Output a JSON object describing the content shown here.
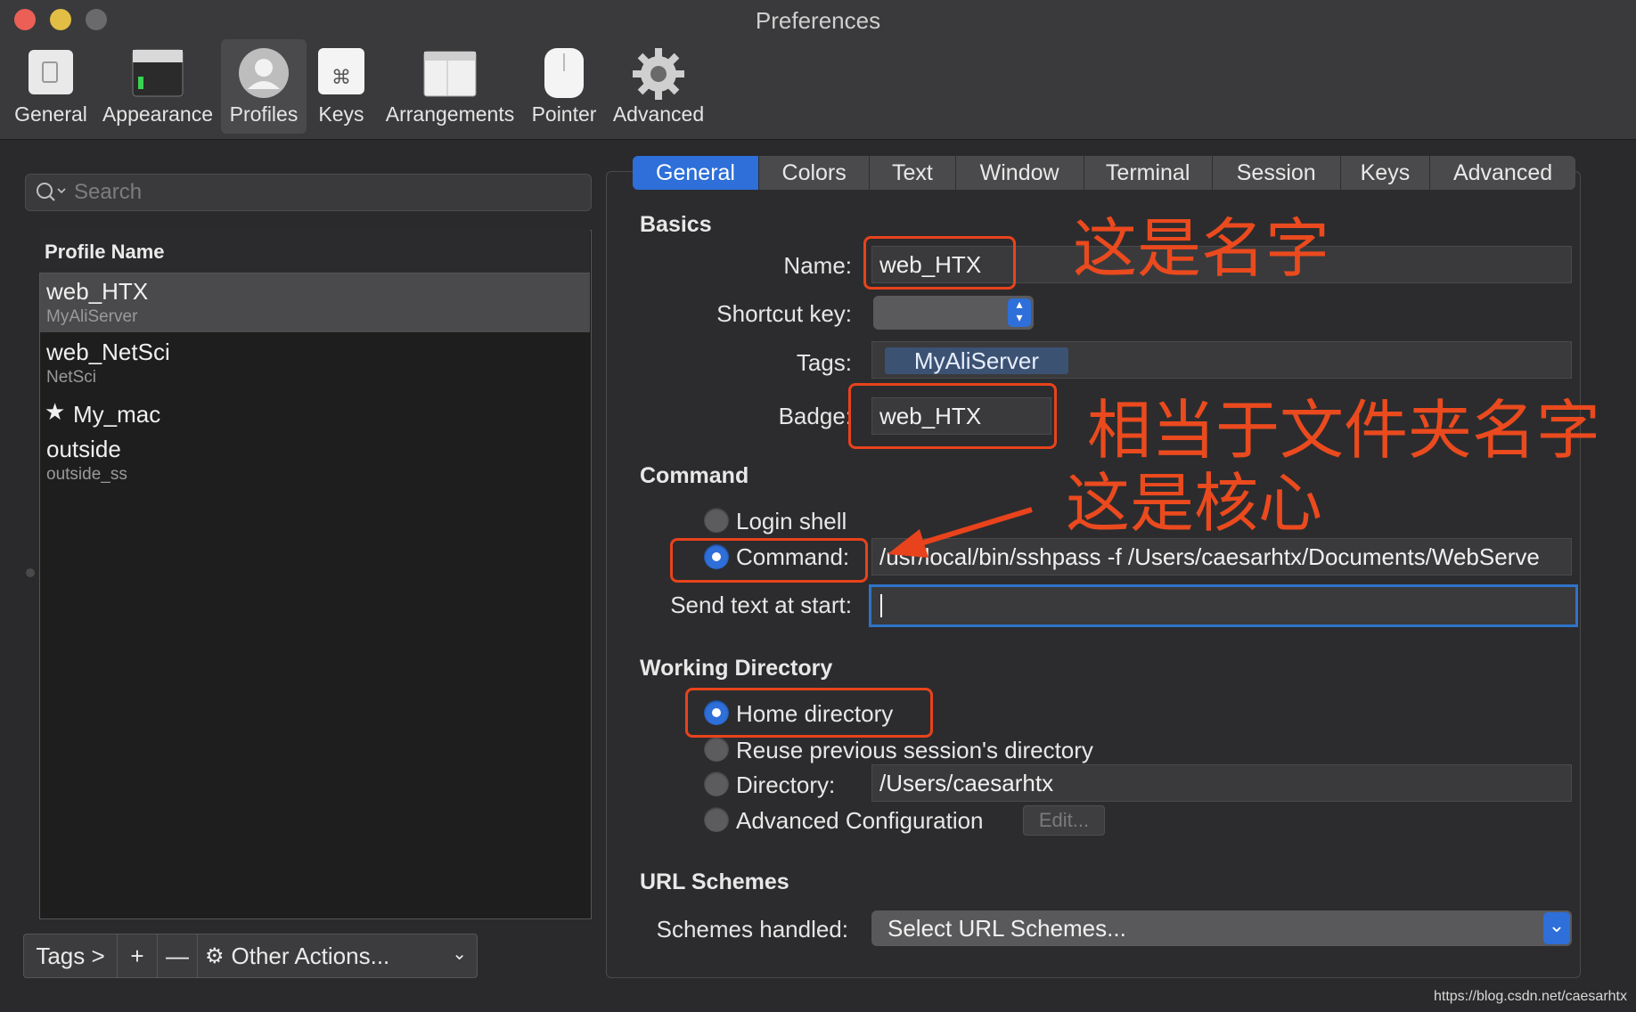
{
  "window": {
    "title": "Preferences"
  },
  "toolbar": {
    "items": [
      {
        "label": "General",
        "icon": "general-icon"
      },
      {
        "label": "Appearance",
        "icon": "appearance-icon"
      },
      {
        "label": "Profiles",
        "icon": "profiles-icon",
        "selected": true
      },
      {
        "label": "Keys",
        "icon": "keys-icon"
      },
      {
        "label": "Arrangements",
        "icon": "arrangements-icon"
      },
      {
        "label": "Pointer",
        "icon": "pointer-icon"
      },
      {
        "label": "Advanced",
        "icon": "gear-icon"
      }
    ]
  },
  "sidebar": {
    "search_placeholder": "Search",
    "column_header": "Profile Name",
    "profiles": [
      {
        "name": "web_HTX",
        "tag": "MyAliServer",
        "selected": true
      },
      {
        "name": "web_NetSci",
        "tag": "NetSci"
      },
      {
        "name": "My_mac",
        "tag": "",
        "default": true
      },
      {
        "name": "outside",
        "tag": "outside_ss"
      }
    ],
    "bottom": {
      "tags": "Tags >",
      "add": "+",
      "remove": "—",
      "other_actions": "Other Actions..."
    }
  },
  "tabs": [
    "General",
    "Colors",
    "Text",
    "Window",
    "Terminal",
    "Session",
    "Keys",
    "Advanced"
  ],
  "basics": {
    "title": "Basics",
    "name_label": "Name:",
    "name_value": "web_HTX",
    "shortcut_label": "Shortcut key:",
    "tags_label": "Tags:",
    "tag_value": "MyAliServer",
    "badge_label": "Badge:",
    "badge_value": "web_HTX"
  },
  "command": {
    "title": "Command",
    "login_shell": "Login shell",
    "command_label": "Command:",
    "command_value": "/usr/local/bin/sshpass -f /Users/caesarhtx/Documents/WebServe",
    "send_text_label": "Send text at start:",
    "send_text_value": ""
  },
  "working_directory": {
    "title": "Working Directory",
    "home": "Home directory",
    "reuse": "Reuse previous session's directory",
    "directory_label": "Directory:",
    "directory_value": "/Users/caesarhtx",
    "advanced": "Advanced Configuration",
    "edit": "Edit..."
  },
  "url_schemes": {
    "title": "URL Schemes",
    "label": "Schemes handled:",
    "value": "Select URL Schemes..."
  },
  "annotations": {
    "name_note": "这是名字",
    "badge_note": "相当于文件夹名字",
    "command_note": "这是核心"
  },
  "watermark": "https://blog.csdn.net/caesarhtx",
  "colors": {
    "accent": "#2e6fd9",
    "annotation": "#e8431c"
  }
}
